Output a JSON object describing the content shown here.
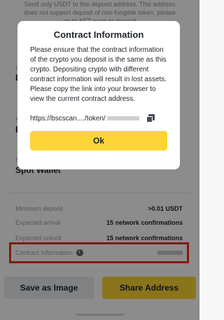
{
  "background": {
    "notice_text": "Send only USDT to this deposit address. This address does not support deposit of non-fungible token, please go to NFT page to deposit",
    "field1_label": "U",
    "field1_value": "D",
    "field2_label": "N",
    "field2_value": "B",
    "field3_label": "S",
    "field3_value": "Spot Wallet",
    "rows": [
      {
        "label": "Minimum deposit",
        "value": ">0.01 USDT"
      },
      {
        "label": "Expected arrival",
        "value": "15 network confirmations"
      },
      {
        "label": "Expected unlock",
        "value": "15 network confirmations"
      }
    ],
    "contract_label": "Contract Information",
    "save_button": "Save as Image",
    "share_button": "Share Address",
    "colors": {
      "accent": "#fcd535",
      "highlight": "#e8341a"
    }
  },
  "modal": {
    "title": "Contract Information",
    "body": "Please ensure that the contract information of the crypto you deposit is the same as this crypto. Depositing crypto with different contract information will result in lost assets. Please copy the link into your browser to view the current contract address.",
    "link_text": "https://bscscan..../token/",
    "ok_label": "Ok"
  }
}
